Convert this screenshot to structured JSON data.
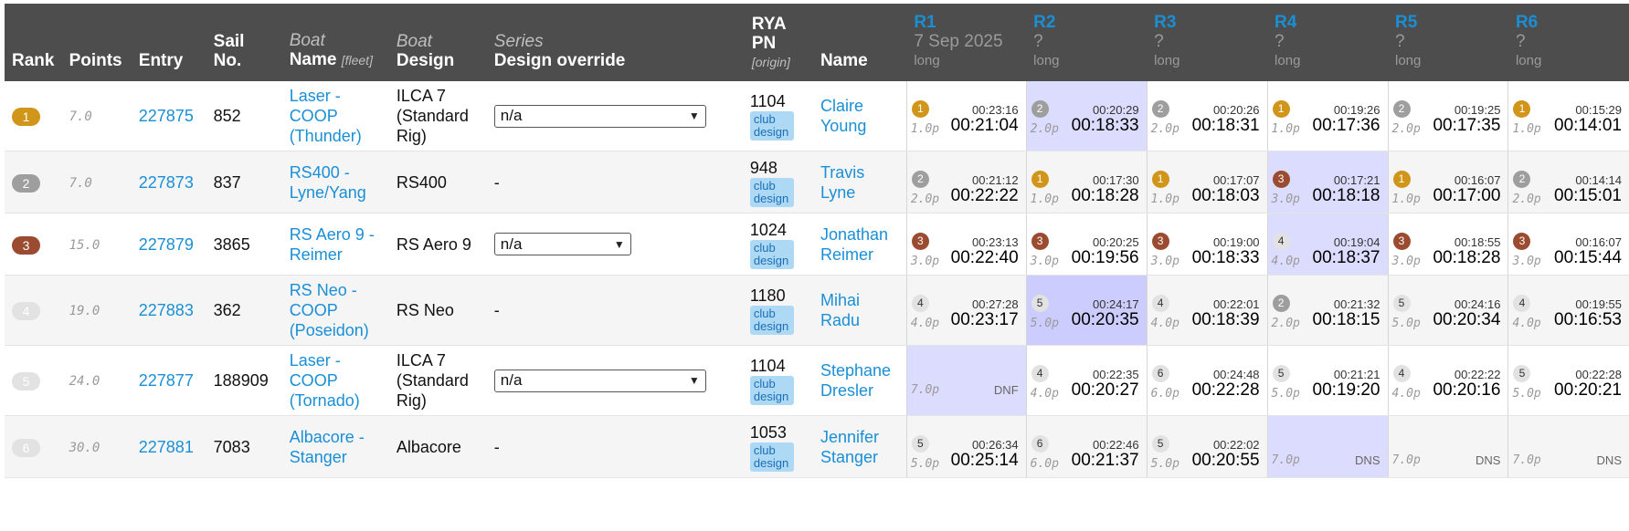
{
  "headers": {
    "rank": "Rank",
    "points": "Points",
    "entry": "Entry",
    "sail": "Sail No.",
    "boat_name_top": "Boat",
    "boat_name": "Name",
    "boat_name_hint": "[fleet]",
    "boat_design_top": "Boat",
    "boat_design": "Design",
    "series_top": "Series",
    "series": "Design override",
    "pn": "RYA PN",
    "pn_hint": "[origin]",
    "name": "Name"
  },
  "races": [
    {
      "label": "R1",
      "date": "7 Sep 2025",
      "course": "long"
    },
    {
      "label": "R2",
      "date": "?",
      "course": "long"
    },
    {
      "label": "R3",
      "date": "?",
      "course": "long"
    },
    {
      "label": "R4",
      "date": "?",
      "course": "long"
    },
    {
      "label": "R5",
      "date": "?",
      "course": "long"
    },
    {
      "label": "R6",
      "date": "?",
      "course": "long"
    }
  ],
  "rows": [
    {
      "rank": "1",
      "points": "7.0",
      "entry": "227875",
      "sail": "852",
      "boat": "Laser - COOP (Thunder)",
      "design": "ILCA 7 (Standard Rig)",
      "override": "n/a",
      "pn": "1104",
      "pn_origin": "club design",
      "sailor": "Claire Young",
      "results": [
        {
          "pos": "1",
          "elapsed": "00:23:16",
          "points": "1.0p",
          "corrected": "00:21:04"
        },
        {
          "pos": "2",
          "elapsed": "00:20:29",
          "points": "2.0p",
          "corrected": "00:18:33"
        },
        {
          "pos": "2",
          "elapsed": "00:20:26",
          "points": "2.0p",
          "corrected": "00:18:31"
        },
        {
          "pos": "1",
          "elapsed": "00:19:26",
          "points": "1.0p",
          "corrected": "00:17:36"
        },
        {
          "pos": "2",
          "elapsed": "00:19:25",
          "points": "2.0p",
          "corrected": "00:17:35"
        },
        {
          "pos": "1",
          "elapsed": "00:15:29",
          "points": "1.0p",
          "corrected": "00:14:01"
        }
      ]
    },
    {
      "rank": "2",
      "points": "7.0",
      "entry": "227873",
      "sail": "837",
      "boat": "RS400 - Lyne/Yang",
      "design": "RS400",
      "override": "-",
      "pn": "948",
      "pn_origin": "club design",
      "sailor": "Travis Lyne",
      "results": [
        {
          "pos": "2",
          "elapsed": "00:21:12",
          "points": "2.0p",
          "corrected": "00:22:22"
        },
        {
          "pos": "1",
          "elapsed": "00:17:30",
          "points": "1.0p",
          "corrected": "00:18:28"
        },
        {
          "pos": "1",
          "elapsed": "00:17:07",
          "points": "1.0p",
          "corrected": "00:18:03"
        },
        {
          "pos": "3",
          "elapsed": "00:17:21",
          "points": "3.0p",
          "corrected": "00:18:18"
        },
        {
          "pos": "1",
          "elapsed": "00:16:07",
          "points": "1.0p",
          "corrected": "00:17:00"
        },
        {
          "pos": "2",
          "elapsed": "00:14:14",
          "points": "2.0p",
          "corrected": "00:15:01"
        }
      ]
    },
    {
      "rank": "3",
      "points": "15.0",
      "entry": "227879",
      "sail": "3865",
      "boat": "RS Aero 9 - Reimer",
      "design": "RS Aero 9",
      "override": "n/a",
      "pn": "1024",
      "pn_origin": "club design",
      "sailor": "Jonathan Reimer",
      "results": [
        {
          "pos": "3",
          "elapsed": "00:23:13",
          "points": "3.0p",
          "corrected": "00:22:40"
        },
        {
          "pos": "3",
          "elapsed": "00:20:25",
          "points": "3.0p",
          "corrected": "00:19:56"
        },
        {
          "pos": "3",
          "elapsed": "00:19:00",
          "points": "3.0p",
          "corrected": "00:18:33"
        },
        {
          "pos": "4",
          "elapsed": "00:19:04",
          "points": "4.0p",
          "corrected": "00:18:37"
        },
        {
          "pos": "3",
          "elapsed": "00:18:55",
          "points": "3.0p",
          "corrected": "00:18:28"
        },
        {
          "pos": "3",
          "elapsed": "00:16:07",
          "points": "3.0p",
          "corrected": "00:15:44"
        }
      ]
    },
    {
      "rank": "4",
      "points": "19.0",
      "entry": "227883",
      "sail": "362",
      "boat": "RS Neo - COOP (Poseidon)",
      "design": "RS Neo",
      "override": "-",
      "pn": "1180",
      "pn_origin": "club design",
      "sailor": "Mihai Radu",
      "results": [
        {
          "pos": "4",
          "elapsed": "00:27:28",
          "points": "4.0p",
          "corrected": "00:23:17"
        },
        {
          "pos": "5",
          "elapsed": "00:24:17",
          "points": "5.0p",
          "corrected": "00:20:35"
        },
        {
          "pos": "4",
          "elapsed": "00:22:01",
          "points": "4.0p",
          "corrected": "00:18:39"
        },
        {
          "pos": "2",
          "elapsed": "00:21:32",
          "points": "2.0p",
          "corrected": "00:18:15"
        },
        {
          "pos": "5",
          "elapsed": "00:24:16",
          "points": "5.0p",
          "corrected": "00:20:34"
        },
        {
          "pos": "4",
          "elapsed": "00:19:55",
          "points": "4.0p",
          "corrected": "00:16:53"
        }
      ]
    },
    {
      "rank": "5",
      "points": "24.0",
      "entry": "227877",
      "sail": "188909",
      "boat": "Laser - COOP (Tornado)",
      "design": "ILCA 7 (Standard Rig)",
      "override": "n/a",
      "pn": "1104",
      "pn_origin": "club design",
      "sailor": "Stephane Dresler",
      "results": [
        {
          "code": "DNF",
          "points": "7.0p"
        },
        {
          "pos": "4",
          "elapsed": "00:22:35",
          "points": "4.0p",
          "corrected": "00:20:27"
        },
        {
          "pos": "6",
          "elapsed": "00:24:48",
          "points": "6.0p",
          "corrected": "00:22:28"
        },
        {
          "pos": "5",
          "elapsed": "00:21:21",
          "points": "5.0p",
          "corrected": "00:19:20"
        },
        {
          "pos": "4",
          "elapsed": "00:22:22",
          "points": "4.0p",
          "corrected": "00:20:16"
        },
        {
          "pos": "5",
          "elapsed": "00:22:28",
          "points": "5.0p",
          "corrected": "00:20:21"
        }
      ]
    },
    {
      "rank": "6",
      "points": "30.0",
      "entry": "227881",
      "sail": "7083",
      "boat": "Albacore - Stanger",
      "design": "Albacore",
      "override": "-",
      "pn": "1053",
      "pn_origin": "club design",
      "sailor": "Jennifer Stanger",
      "results": [
        {
          "pos": "5",
          "elapsed": "00:26:34",
          "points": "5.0p",
          "corrected": "00:25:14"
        },
        {
          "pos": "6",
          "elapsed": "00:22:46",
          "points": "6.0p",
          "corrected": "00:21:37"
        },
        {
          "pos": "5",
          "elapsed": "00:22:02",
          "points": "5.0p",
          "corrected": "00:20:55"
        },
        {
          "code": "DNS",
          "points": "7.0p"
        },
        {
          "code": "DNS",
          "points": "7.0p"
        },
        {
          "code": "DNS",
          "points": "7.0p"
        }
      ]
    }
  ]
}
